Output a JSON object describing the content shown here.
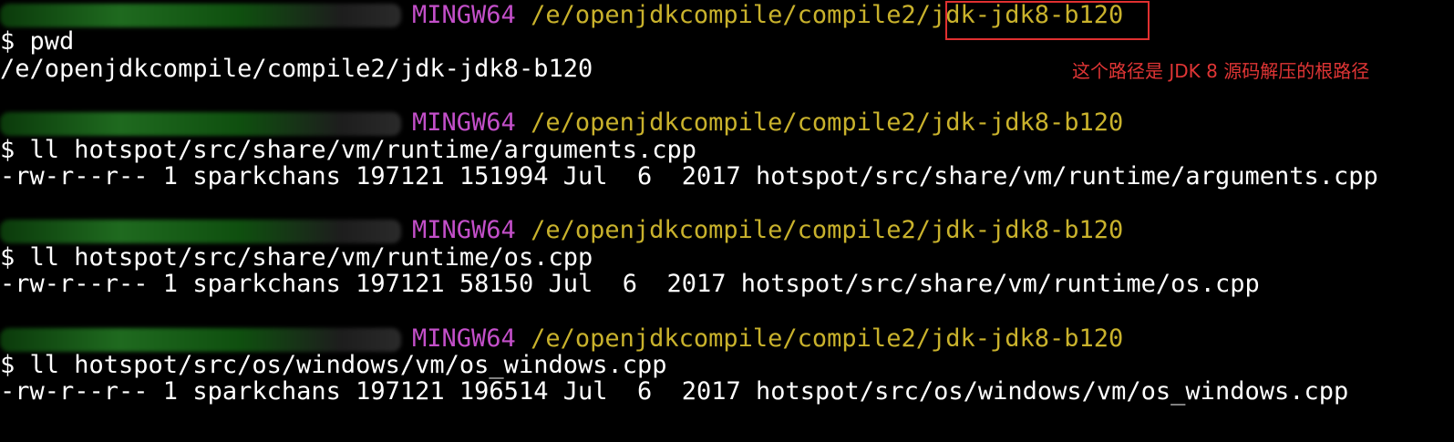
{
  "terminal": {
    "blocks": [
      {
        "user_host": "sparkchans@DESKTOP-9BJ3S17",
        "env": "MINGW64",
        "cwd": "/e/openjdkcompile/compile2/jdk-jdk8-b120",
        "command": "$ pwd",
        "output": "/e/openjdkcompile/compile2/jdk-jdk8-b120"
      },
      {
        "user_host": "sparkchans@DESKTOP-9BJ3S17",
        "env": "MINGW64",
        "cwd": "/e/openjdkcompile/compile2/jdk-jdk8-b120",
        "command": "$ ll hotspot/src/share/vm/runtime/arguments.cpp",
        "output": "-rw-r--r-- 1 sparkchans 197121 151994 Jul  6  2017 hotspot/src/share/vm/runtime/arguments.cpp"
      },
      {
        "user_host": "sparkchans@DESKTOP-9BJ3S17",
        "env": "MINGW64",
        "cwd": "/e/openjdkcompile/compile2/jdk-jdk8-b120",
        "command": "$ ll hotspot/src/share/vm/runtime/os.cpp",
        "output": "-rw-r--r-- 1 sparkchans 197121 58150 Jul  6  2017 hotspot/src/share/vm/runtime/os.cpp"
      },
      {
        "user_host": "sparkchans@DESKTOP-9BJ3S17",
        "env": "MINGW64",
        "cwd": "/e/openjdkcompile/compile2/jdk-jdk8-b120",
        "command": "$ ll hotspot/src/os/windows/vm/os_windows.cpp",
        "output": "-rw-r--r-- 1 sparkchans 197121 196514 Jul  6  2017 hotspot/src/os/windows/vm/os_windows.cpp"
      }
    ],
    "first_cwd_prefix": "/e/openjdkcompile/compile2/",
    "first_cwd_highlighted": "jdk-jdk8-b120",
    "annotation": "这个路径是 JDK 8 源码解压的根路径"
  },
  "colors": {
    "background": "#000000",
    "user_host": "#1ea51e",
    "env": "#c34fc9",
    "path": "#c9b22c",
    "text": "#ffffff",
    "highlight": "#e03030"
  }
}
